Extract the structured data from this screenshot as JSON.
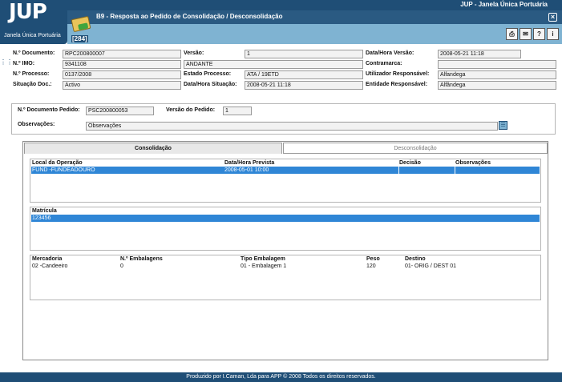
{
  "app": {
    "logo": "JUP",
    "subtitle": "Janela Única Portuária",
    "title": "JUP - Janela Única Portuária"
  },
  "page": {
    "title": "B9 - Resposta ao Pedido de Consolidação / Desconsolidação",
    "doc_count": "[284]"
  },
  "toolbar": {
    "icons": [
      "print-icon",
      "email-icon",
      "help-icon",
      "info-icon"
    ]
  },
  "header_fields": {
    "num_documento": {
      "label": "N.º Documento:",
      "value": "RPC200800007"
    },
    "versao": {
      "label": "Versão:",
      "value": "1"
    },
    "data_hora_versao": {
      "label": "Data/Hora Versão:",
      "value": "2008-05-21 11:18"
    },
    "num_imo": {
      "label": "N.º IMO:",
      "value": "9341108"
    },
    "nome_navio": {
      "value": "ANDANTE"
    },
    "contramarca": {
      "label": "Contramarca:",
      "value": ""
    },
    "num_processo": {
      "label": "N.º Processo:",
      "value": "0137/2008"
    },
    "estado_processo": {
      "label": "Estado Processo:",
      "value": "ATA /   19ETD"
    },
    "utilizador_responsavel": {
      "label": "Utilizador Responsável:",
      "value": "Alfandega"
    },
    "situacao_doc": {
      "label": "Situação Doc.:",
      "value": "Activo"
    },
    "data_hora_situacao": {
      "label": "Data/Hora Situação:",
      "value": "2008-05-21 11:18"
    },
    "entidade_responsavel": {
      "label": "Entidade Responsável:",
      "value": "Alfândega"
    }
  },
  "pedido": {
    "num_documento_pedido": {
      "label": "N.º Documento Pedido:",
      "value": "PSC200800053"
    },
    "versao_pedido": {
      "label": "Versão do Pedido:",
      "value": "1"
    },
    "observacoes": {
      "label": "Observações:",
      "value": "Observações"
    }
  },
  "tabs": {
    "consolidacao": "Consolidação",
    "desconsolidacao": "Desconsolidação"
  },
  "operacao_table": {
    "columns": [
      "Local da Operação",
      "Data/Hora Prevista",
      "Decisão",
      "Observações"
    ],
    "rows": [
      [
        "FUND -FUNDEADOURO",
        "2008-05-01 10:00",
        "",
        ""
      ]
    ]
  },
  "matricula_table": {
    "columns": [
      "Matrícula"
    ],
    "rows": [
      [
        "123456"
      ]
    ]
  },
  "mercadoria_table": {
    "columns": [
      "Mercadoria",
      "N.º Embalagens",
      "Tipo Embalagem",
      "Peso",
      "Destino"
    ],
    "rows": [
      [
        "02 -Candeeiro",
        "0",
        "01 - Embalagem 1",
        "120",
        "01- ORIG / DEST 01"
      ]
    ]
  },
  "footer": {
    "text": "Produzido por I.Caman, Lda para APP © 2008 Todos os direitos reservados."
  },
  "colors": {
    "header_dark": "#1f4e76",
    "subbar": "#7fb3d2",
    "selection": "#2f86d6"
  }
}
